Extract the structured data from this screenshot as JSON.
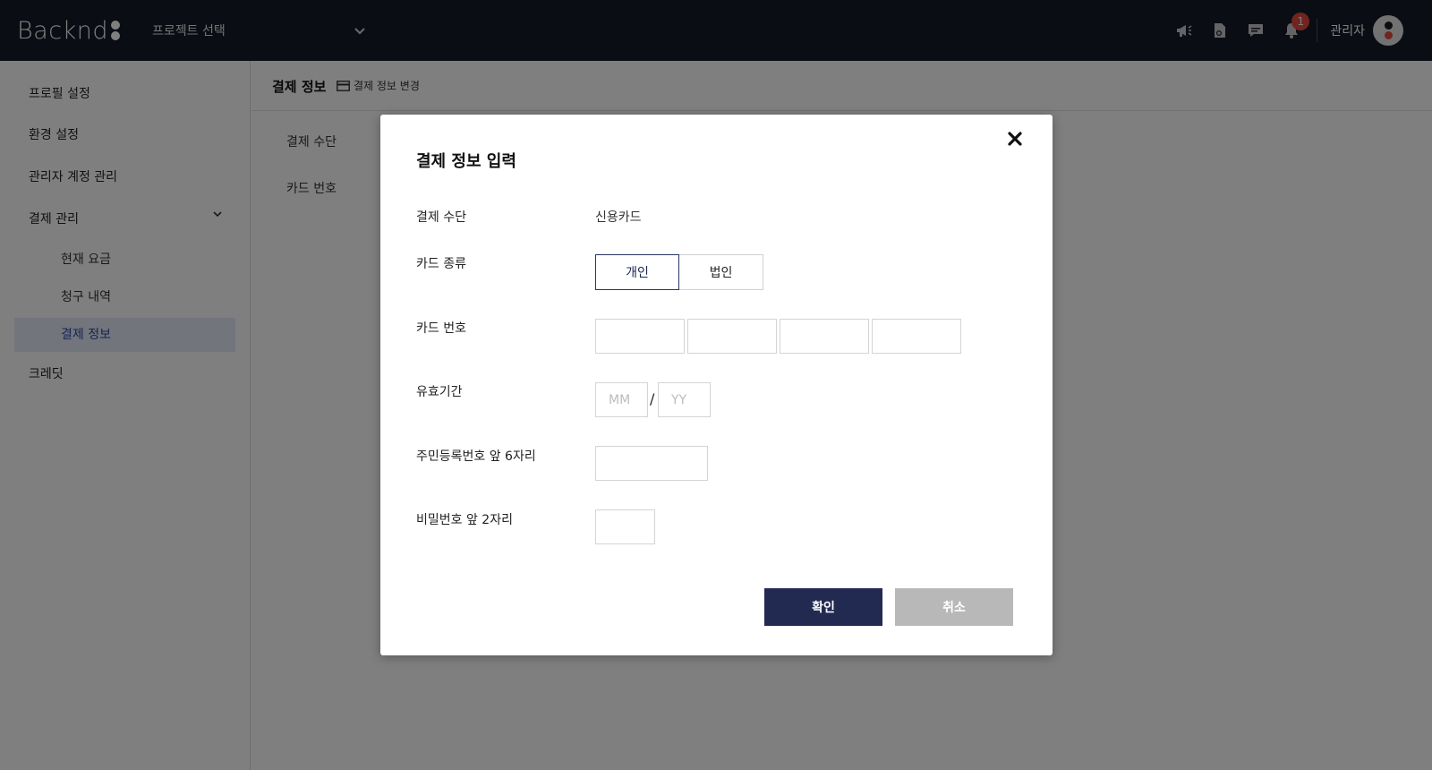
{
  "app": {
    "logo_text": "Backnd",
    "project_select": "프로젝트 선택",
    "notification_count": "1",
    "admin_name": "관리자"
  },
  "sidebar": {
    "items": [
      {
        "label": "프로필 설정"
      },
      {
        "label": "환경 설정"
      },
      {
        "label": "관리자 계정 관리"
      },
      {
        "label": "결제 관리"
      },
      {
        "label": "크레딧"
      }
    ],
    "sub_items": [
      {
        "label": "현재 요금"
      },
      {
        "label": "청구 내역"
      },
      {
        "label": "결제 정보",
        "active": true
      }
    ]
  },
  "main": {
    "title": "결제 정보",
    "change_link": "결제 정보 변경",
    "rows": [
      {
        "label": "결제 수단"
      },
      {
        "label": "카드 번호"
      }
    ]
  },
  "modal": {
    "title": "결제 정보 입력",
    "fields": {
      "payment_method_label": "결제 수단",
      "payment_method_value": "신용카드",
      "card_type_label": "카드 종류",
      "card_type_personal": "개인",
      "card_type_corporate": "법인",
      "card_type_selected": "개인",
      "card_number_label": "카드 번호",
      "card_number_values": [
        "",
        "",
        "",
        ""
      ],
      "expiry_label": "유효기간",
      "expiry_month_placeholder": "MM",
      "expiry_year_placeholder": "YY",
      "expiry_separator": "/",
      "rrn_label": "주민등록번호 앞 6자리",
      "password_label": "비밀번호 앞 2자리"
    },
    "confirm_label": "확인",
    "cancel_label": "취소"
  },
  "colors": {
    "topbar": "#161a29",
    "primary": "#232a52",
    "cancel": "#b8b8b8",
    "badge": "#e14b3c",
    "active_bg": "#e4eaf8",
    "active_text": "#2e4aa8"
  }
}
